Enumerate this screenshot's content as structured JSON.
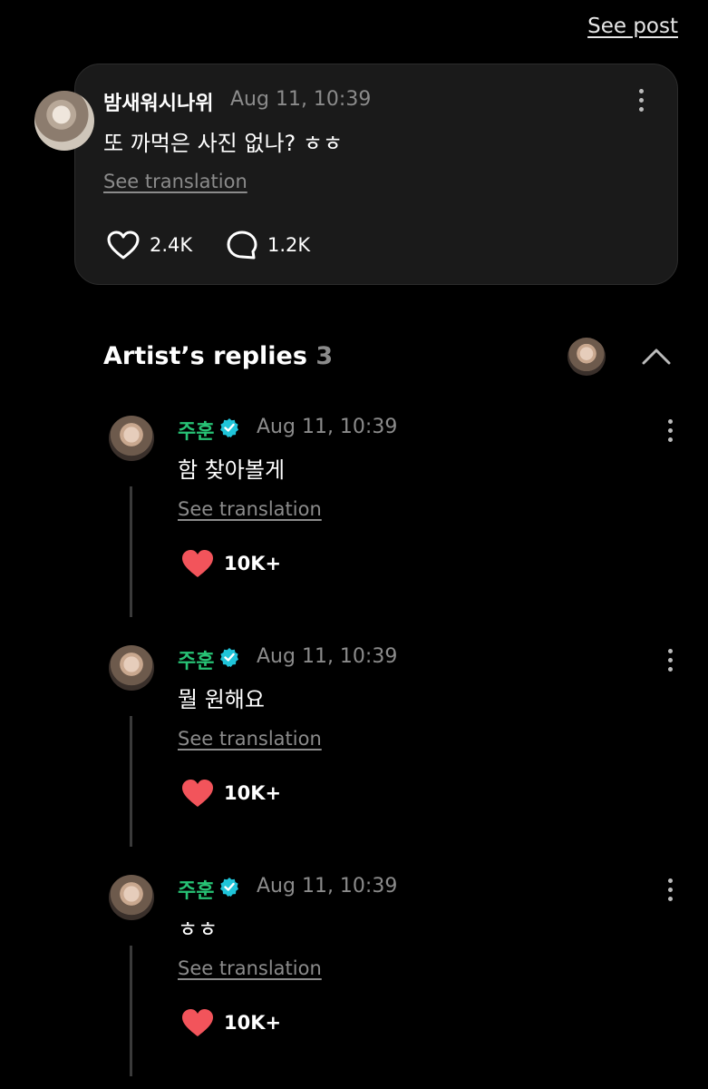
{
  "header": {
    "see_post_label": "See post"
  },
  "fan_post": {
    "username": "밤새워시나위",
    "timestamp": "Aug 11, 10:39",
    "text": "또 까먹은 사진 없나? ㅎㅎ",
    "translation_label": "See translation",
    "likes": "2.4K",
    "comments": "1.2K"
  },
  "artist_replies": {
    "title": "Artist’s replies",
    "count": "3",
    "replies": [
      {
        "username": "주훈",
        "timestamp": "Aug 11, 10:39",
        "text": "함 찾아볼게",
        "translation_label": "See translation",
        "likes": "10K+"
      },
      {
        "username": "주훈",
        "timestamp": "Aug 11, 10:39",
        "text": "뭘 원해요",
        "translation_label": "See translation",
        "likes": "10K+"
      },
      {
        "username": "주훈",
        "timestamp": "Aug 11, 10:39",
        "text": "ㅎㅎ",
        "translation_label": "See translation",
        "likes": "10K+"
      }
    ]
  },
  "colors": {
    "background": "#000000",
    "card": "#1a1a1a",
    "artist_name": "#27c275",
    "verified_badge": "#1fc4d9",
    "heart_filled": "#f2545b",
    "muted_text": "#8b8b8b"
  },
  "icons": {
    "like": "heart-outline-icon",
    "comment": "speech-bubble-icon",
    "more": "kebab-menu-icon",
    "collapse": "chevron-up-icon",
    "verified": "verified-badge-icon",
    "liked": "heart-filled-icon"
  }
}
